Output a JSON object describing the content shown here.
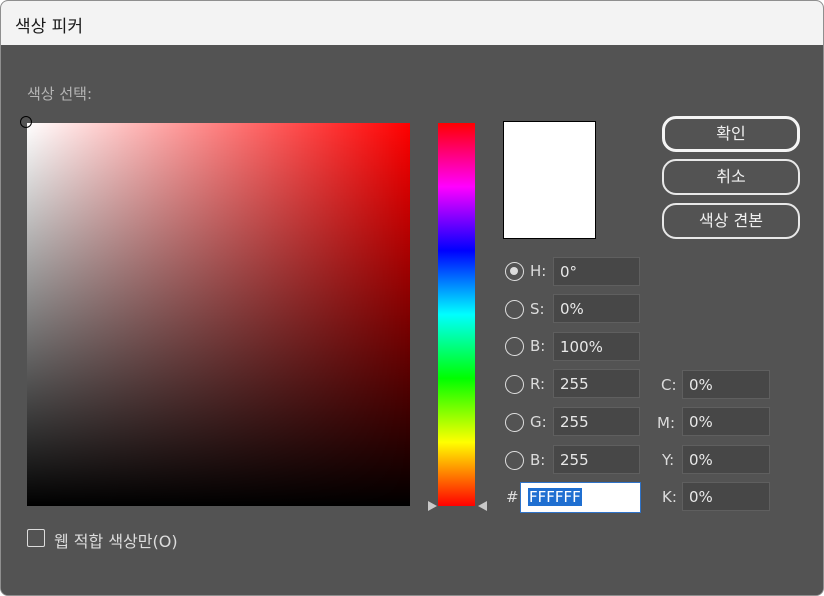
{
  "window": {
    "title": "색상 피커"
  },
  "picker": {
    "label": "색상 선택:",
    "current_color": "#FFFFFF",
    "hue_color": "#FF0000"
  },
  "buttons": {
    "ok": "확인",
    "cancel": "취소",
    "swatches": "색상 견본"
  },
  "hsb": [
    {
      "label": "H:",
      "value": "0°",
      "selected": true
    },
    {
      "label": "S:",
      "value": "0%",
      "selected": false
    },
    {
      "label": "B:",
      "value": "100%",
      "selected": false
    }
  ],
  "rgb": [
    {
      "label": "R:",
      "value": "255",
      "selected": false
    },
    {
      "label": "G:",
      "value": "255",
      "selected": false
    },
    {
      "label": "B:",
      "value": "255",
      "selected": false
    }
  ],
  "cmyk": [
    {
      "label": "C:",
      "value": "0%"
    },
    {
      "label": "M:",
      "value": "0%"
    },
    {
      "label": "Y:",
      "value": "0%"
    },
    {
      "label": "K:",
      "value": "0%"
    }
  ],
  "hex": {
    "prefix": "#",
    "value": "FFFFFF"
  },
  "web_only": {
    "label": "웹 적합 색상만(O)",
    "checked": false
  }
}
